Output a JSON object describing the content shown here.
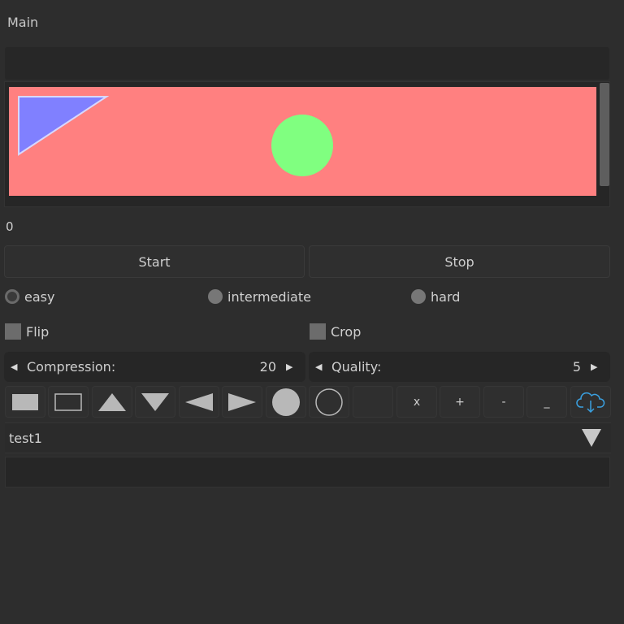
{
  "window": {
    "title": "Main"
  },
  "canvas": {
    "background_color": "#ff8080",
    "shapes": [
      {
        "type": "triangle",
        "fill": "#8080ff",
        "stroke": "#d8d8ff"
      },
      {
        "type": "circle",
        "fill": "#80ff80"
      }
    ]
  },
  "value_label": "0",
  "buttons": {
    "start": "Start",
    "stop": "Stop"
  },
  "difficulty": {
    "options": [
      {
        "label": "easy",
        "selected": true
      },
      {
        "label": "intermediate",
        "selected": false
      },
      {
        "label": "hard",
        "selected": false
      }
    ]
  },
  "checkboxes": [
    {
      "label": "Flip",
      "checked": false
    },
    {
      "label": "Crop",
      "checked": false
    }
  ],
  "spinners": [
    {
      "label": "Compression:",
      "value": "20",
      "left_arrow": "◀",
      "right_arrow": "▶"
    },
    {
      "label": "Quality:",
      "value": "5",
      "left_arrow": "◀",
      "right_arrow": "▶"
    }
  ],
  "toolbar": {
    "items": [
      {
        "icon": "filled-rectangle-icon"
      },
      {
        "icon": "outline-rectangle-icon"
      },
      {
        "icon": "triangle-up-icon"
      },
      {
        "icon": "triangle-down-icon"
      },
      {
        "icon": "triangle-left-icon"
      },
      {
        "icon": "triangle-right-icon"
      },
      {
        "icon": "filled-circle-icon"
      },
      {
        "icon": "outline-circle-icon"
      },
      {
        "icon": "blank",
        "label": ""
      },
      {
        "icon": "text",
        "label": "x"
      },
      {
        "icon": "text",
        "label": "+"
      },
      {
        "icon": "text",
        "label": "-"
      },
      {
        "icon": "text",
        "label": "_"
      },
      {
        "icon": "cloud-download-icon",
        "color": "#3aa0e0"
      }
    ]
  },
  "dropdown": {
    "selected": "test1"
  },
  "text_input": {
    "value": ""
  }
}
